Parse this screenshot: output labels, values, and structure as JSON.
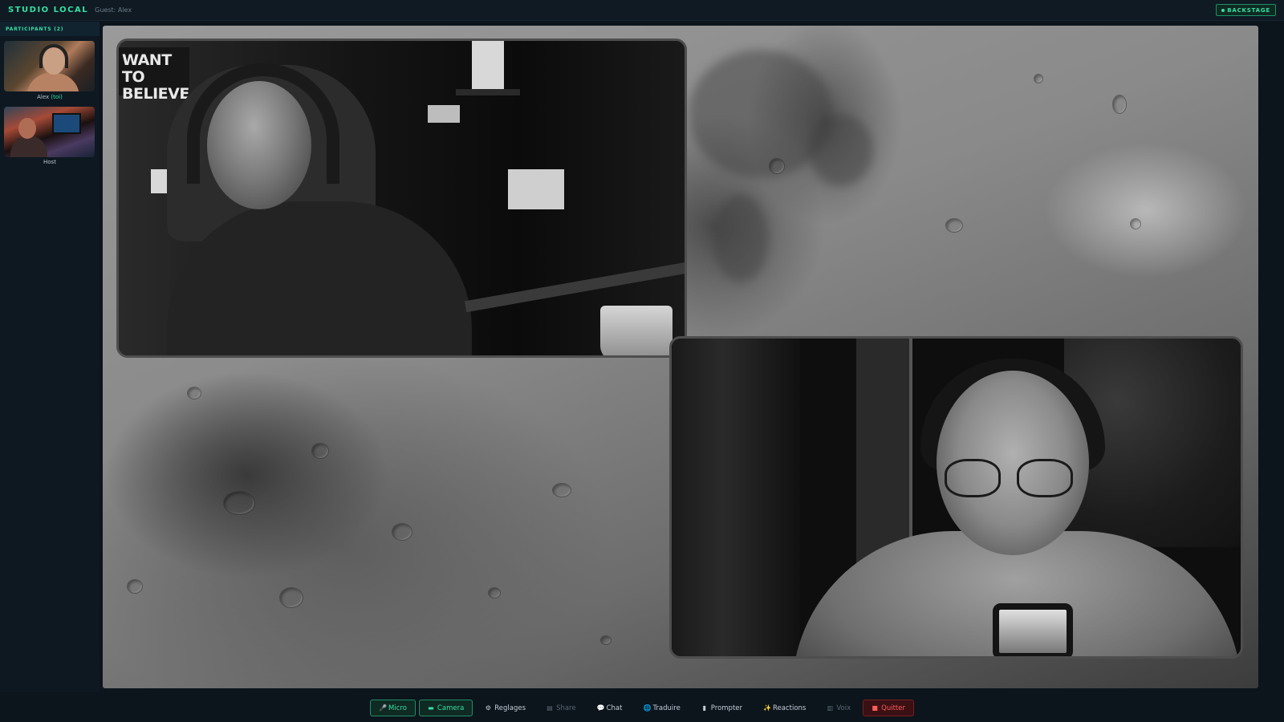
{
  "topbar": {
    "brand": "STUDIO LOCAL",
    "guest_label": "Guest: Alex",
    "backstage_label": "BACKSTAGE",
    "accent": "#34e0a4"
  },
  "sidebar": {
    "header": "PARTICIPANTS (2)",
    "participants": [
      {
        "name": "Alex",
        "you_tag": "(toi)"
      },
      {
        "name": "Host",
        "you_tag": ""
      }
    ]
  },
  "stage": {
    "background": "moon-surface",
    "tiles": [
      {
        "participant": "Host",
        "poster_text": "WANT TO BELIEVE"
      },
      {
        "participant": "Alex"
      }
    ]
  },
  "toolbar": {
    "buttons": [
      {
        "label": "Micro",
        "icon": "mic-icon",
        "glyph": "🎤",
        "state": "on"
      },
      {
        "label": "Camera",
        "icon": "camera-icon",
        "glyph": "▬",
        "state": "on"
      },
      {
        "label": "Reglages",
        "icon": "gear-icon",
        "glyph": "⚙",
        "state": "normal"
      },
      {
        "label": "Share",
        "icon": "screen-share-icon",
        "glyph": "▤",
        "state": "disabled"
      },
      {
        "label": "Chat",
        "icon": "chat-icon",
        "glyph": "💬",
        "state": "normal"
      },
      {
        "label": "Traduire",
        "icon": "globe-icon",
        "glyph": "🌐",
        "state": "normal"
      },
      {
        "label": "Prompter",
        "icon": "prompter-icon",
        "glyph": "▮",
        "state": "normal"
      },
      {
        "label": "Reactions",
        "icon": "sparkle-icon",
        "glyph": "✨",
        "state": "normal"
      },
      {
        "label": "Voix",
        "icon": "voice-icon",
        "glyph": "▥",
        "state": "disabled"
      },
      {
        "label": "Quitter",
        "icon": "exit-icon",
        "glyph": "■",
        "state": "danger"
      }
    ],
    "danger_color": "#ff5c5c"
  }
}
